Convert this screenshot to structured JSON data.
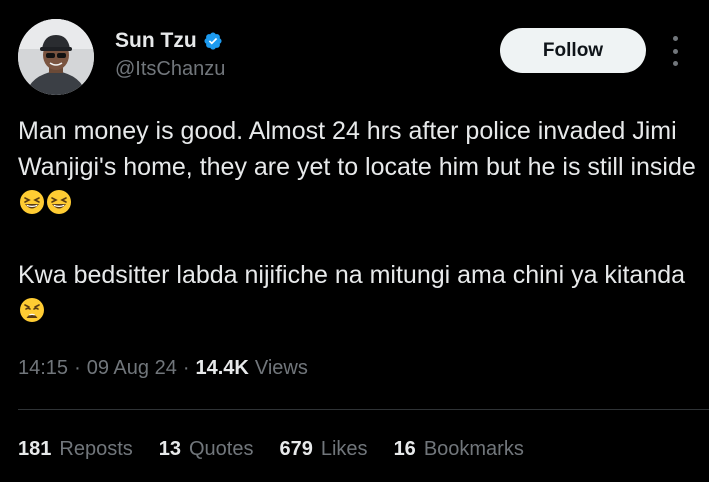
{
  "author": {
    "display_name": "Sun Tzu",
    "handle": "@ItsChanzu",
    "verified": true,
    "avatar_icon": "profile-photo"
  },
  "actions": {
    "follow_label": "Follow",
    "more_icon": "more-options-icon"
  },
  "tweet": {
    "paragraph1": "Man money is good. Almost 24 hrs after police invaded Jimi Wanjigi's home, they are yet to locate him but he is still inside",
    "paragraph1_emojis": [
      "grinning-squinting-face",
      "grinning-squinting-face"
    ],
    "paragraph2": "Kwa bedsitter labda nijifiche na mitungi ama chini ya kitanda",
    "paragraph2_emojis": [
      "weary-face"
    ]
  },
  "meta": {
    "time": "14:15",
    "date": "09 Aug 24",
    "views_count": "14.4K",
    "views_label": "Views"
  },
  "stats": [
    {
      "count": "181",
      "label": "Reposts"
    },
    {
      "count": "13",
      "label": "Quotes"
    },
    {
      "count": "679",
      "label": "Likes"
    },
    {
      "count": "16",
      "label": "Bookmarks"
    }
  ],
  "colors": {
    "background": "#000000",
    "text_primary": "#e7e9ea",
    "text_secondary": "#71767b",
    "verified_blue": "#1d9bf0",
    "follow_bg": "#eff3f4",
    "divider": "#2f3336"
  }
}
